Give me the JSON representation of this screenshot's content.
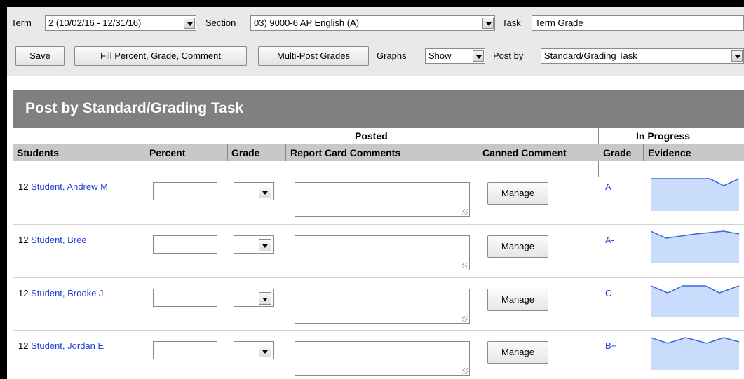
{
  "toolbar": {
    "term_label": "Term",
    "term_value": "2 (10/02/16 - 12/31/16)",
    "section_label": "Section",
    "section_value": "03) 9000-6 AP English (A)",
    "task_label": "Task",
    "task_value": "Term Grade",
    "save_label": "Save",
    "fill_label": "Fill Percent, Grade, Comment",
    "multipost_label": "Multi-Post Grades",
    "graphs_label": "Graphs",
    "graphs_value": "Show",
    "postby_label": "Post by",
    "postby_value": "Standard/Grading Task"
  },
  "banner": {
    "title": "Post by Standard/Grading Task"
  },
  "table": {
    "group_posted": "Posted",
    "group_inprogress": "In Progress",
    "col_students": "Students",
    "col_percent": "Percent",
    "col_grade": "Grade",
    "col_comments": "Report Card Comments",
    "col_canned": "Canned Comment",
    "col_ip_grade": "Grade",
    "col_evidence": "Evidence",
    "manage_label": "Manage",
    "rows": [
      {
        "num": "12",
        "name": "Student, Andrew M",
        "grade": "A"
      },
      {
        "num": "12",
        "name": "Student, Bree",
        "grade": "A-"
      },
      {
        "num": "12",
        "name": "Student, Brooke J",
        "grade": "C"
      },
      {
        "num": "12",
        "name": "Student, Jordan E",
        "grade": "B+"
      }
    ]
  },
  "colors": {
    "banner": "#808080",
    "link": "#1f3fd6",
    "spark_fill": "#c9dcfb",
    "spark_line": "#3a66d8"
  }
}
